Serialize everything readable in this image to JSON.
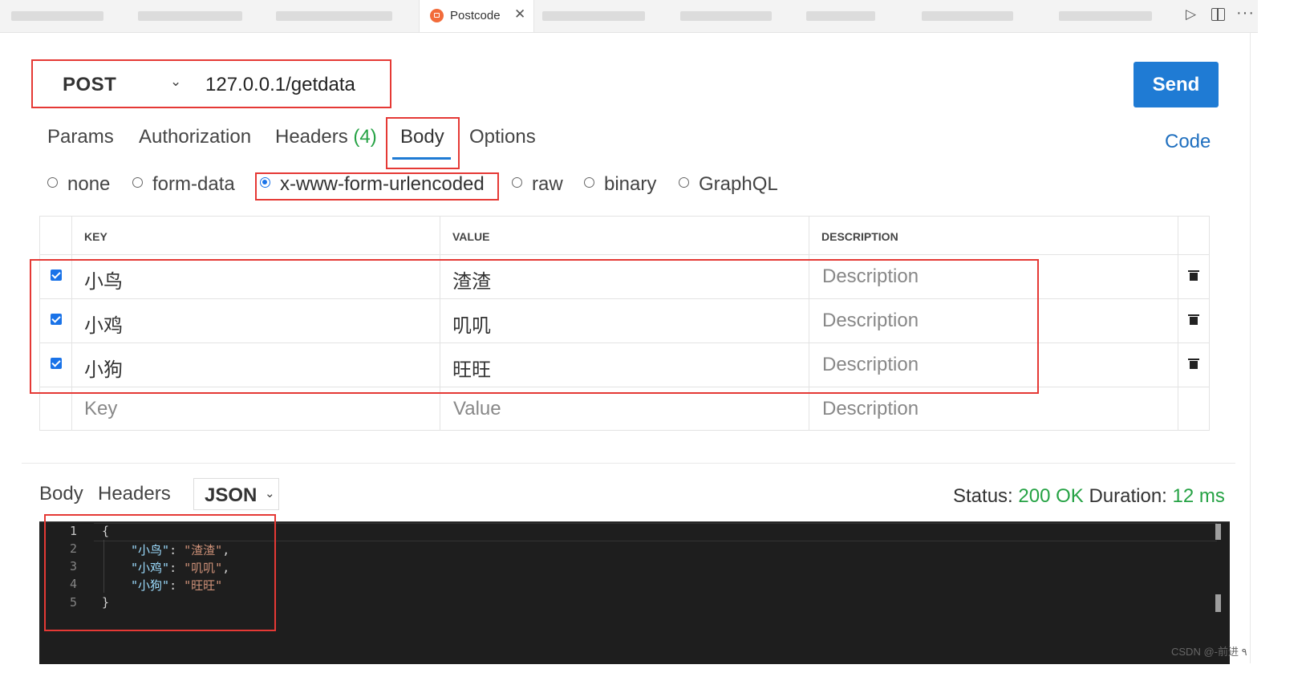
{
  "tabs": {
    "active_label": "Postcode",
    "close_glyph": "✕"
  },
  "request": {
    "method": "POST",
    "url": "127.0.0.1/getdata",
    "send_label": "Send"
  },
  "request_tabs": {
    "params": "Params",
    "authorization": "Authorization",
    "headers": "Headers",
    "headers_count": "(4)",
    "body": "Body",
    "options": "Options",
    "code": "Code"
  },
  "body_types": {
    "none": "none",
    "form_data": "form-data",
    "urlencoded": "x-www-form-urlencoded",
    "raw": "raw",
    "binary": "binary",
    "graphql": "GraphQL",
    "selected": "x-www-form-urlencoded"
  },
  "table": {
    "headers": {
      "key": "KEY",
      "value": "VALUE",
      "description": "DESCRIPTION"
    },
    "rows": [
      {
        "key": "小鸟",
        "value": "渣渣",
        "description": "Description",
        "checked": true
      },
      {
        "key": "小鸡",
        "value": "叽叽",
        "description": "Description",
        "checked": true
      },
      {
        "key": "小狗",
        "value": "旺旺",
        "description": "Description",
        "checked": true
      }
    ],
    "placeholders": {
      "key": "Key",
      "value": "Value",
      "description": "Description"
    }
  },
  "response": {
    "body_tab": "Body",
    "headers_tab": "Headers",
    "format": "JSON",
    "status_label": "Status:",
    "status_value": "200 OK",
    "duration_label": "Duration:",
    "duration_value": "12 ms",
    "line_numbers": [
      "1",
      "2",
      "3",
      "4",
      "5"
    ],
    "code": {
      "open": "{",
      "close": "}",
      "lines": [
        {
          "key": "\"小鸟\"",
          "value": "\"渣渣\"",
          "sep": ": ",
          "end": ","
        },
        {
          "key": "\"小鸡\"",
          "value": "\"叽叽\"",
          "sep": ": ",
          "end": ","
        },
        {
          "key": "\"小狗\"",
          "value": "\"旺旺\"",
          "sep": ": ",
          "end": ""
        }
      ]
    }
  },
  "watermark": "CSDN @-前进 ٩",
  "colors": {
    "accent": "#1f7bd4",
    "success": "#25a244",
    "highlight": "#e53935",
    "editor_bg": "#1e1e1e"
  },
  "icons": [
    "postcode-tab-icon",
    "close-icon",
    "run-icon",
    "split-editor-icon",
    "more-icon",
    "chevron-down-icon",
    "trash-icon"
  ]
}
